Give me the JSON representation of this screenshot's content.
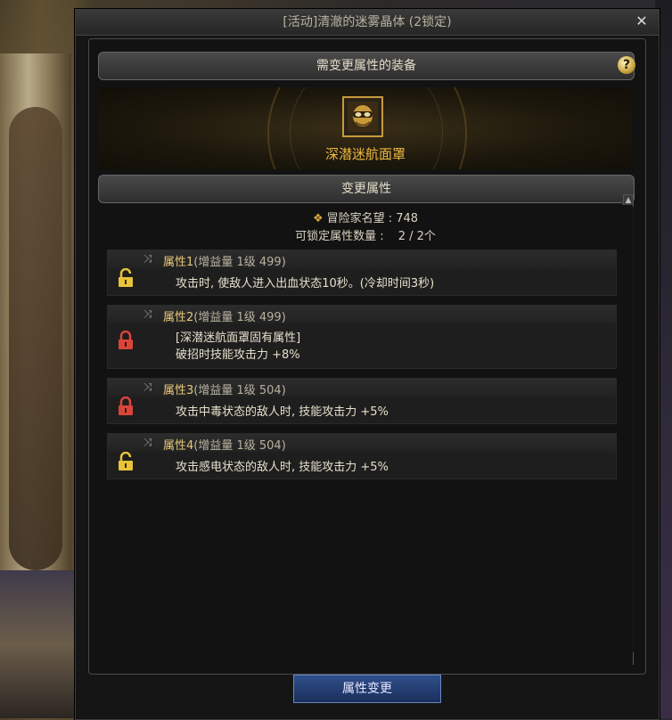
{
  "window": {
    "title": "[活动]清澈的迷雾晶体 (2锁定)"
  },
  "equip_section": {
    "header": "需变更属性的装备",
    "item_name": "深潜迷航面罩"
  },
  "change_section": {
    "header": "变更属性"
  },
  "fame": {
    "label": "冒险家名望 : 748"
  },
  "lock_count": {
    "label": "可锁定属性数量 :",
    "value": "2 / 2个"
  },
  "attributes": [
    {
      "name": "属性1",
      "meta": "(增益量 1级 499)",
      "lines": [
        "攻击时, 使敌人进入出血状态10秒。(冷却时间3秒)"
      ],
      "lock": "unlocked"
    },
    {
      "name": "属性2",
      "meta": "(增益量 1级 499)",
      "lines": [
        "[深潜迷航面罩固有属性]",
        "破招时技能攻击力 +8%"
      ],
      "lock": "locked"
    },
    {
      "name": "属性3",
      "meta": "(增益量 1级 504)",
      "lines": [
        "攻击中毒状态的敌人时, 技能攻击力 +5%"
      ],
      "lock": "locked"
    },
    {
      "name": "属性4",
      "meta": "(增益量 1级 504)",
      "lines": [
        "攻击感电状态的敌人时, 技能攻击力 +5%"
      ],
      "lock": "unlocked"
    }
  ],
  "apply_button": {
    "label": "属性变更"
  },
  "colors": {
    "unlocked_lock": "#e8c23a",
    "locked_lock": "#d9453a",
    "item_name": "#f0b840",
    "button": "#2f4f8a"
  }
}
